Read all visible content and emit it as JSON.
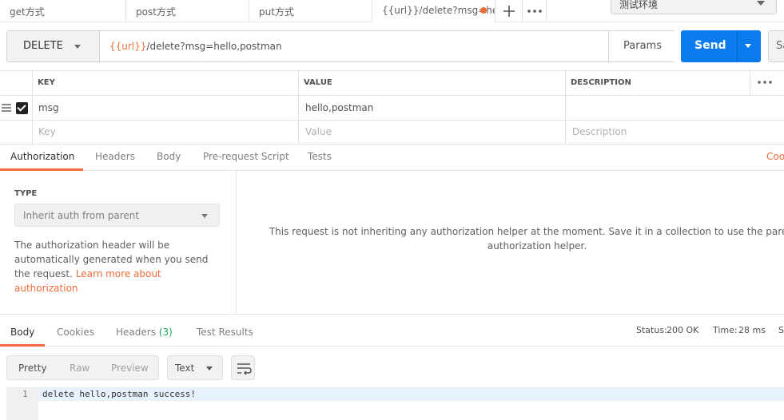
{
  "tabs": [
    {
      "label": "get方式"
    },
    {
      "label": "post方式"
    },
    {
      "label": "put方式"
    },
    {
      "label": "{{url}}/delete?msg=he",
      "modified": true
    }
  ],
  "environment": {
    "selected": "测试环境"
  },
  "request": {
    "method": "DELETE",
    "url_var": "{{url}}",
    "url_rest": "/delete?msg=hello,postman",
    "params_label": "Params",
    "send_label": "Send",
    "save_label": "Sa"
  },
  "params_table": {
    "headers": [
      "KEY",
      "VALUE",
      "DESCRIPTION"
    ],
    "rows": [
      {
        "key": "msg",
        "value": "hello,postman",
        "description": "",
        "checked": true
      }
    ],
    "placeholders": {
      "key": "Key",
      "value": "Value",
      "description": "Description"
    }
  },
  "request_tabs": {
    "items": [
      "Authorization",
      "Headers",
      "Body",
      "Pre-request Script",
      "Tests"
    ],
    "active": "Authorization",
    "right_link": "Coo"
  },
  "auth": {
    "type_label": "TYPE",
    "type_value": "Inherit auth from parent",
    "desc_prefix": "The authorization header will be automatically generated when you send the request. ",
    "desc_link": "Learn more about authorization",
    "message": "This request is not inheriting any authorization helper at the moment. Save it in a collection to use the parent's authorization helper."
  },
  "response": {
    "tabs": {
      "body": "Body",
      "cookies": "Cookies",
      "headers": "Headers",
      "headers_count": "(3)",
      "tests": "Test Results"
    },
    "status_label": "Status:",
    "status_value": "200 OK",
    "time_label": "Time:",
    "time_value": "28 ms",
    "size_label": "S",
    "format_buttons": [
      "Pretty",
      "Raw",
      "Preview"
    ],
    "format_active": "Pretty",
    "text_type": "Text",
    "lines": [
      {
        "num": "1",
        "text": "delete hello,postman success!"
      }
    ]
  },
  "colors": {
    "accent": "#f26b3a",
    "send": "#097bed",
    "status_ok": "#18a65b"
  }
}
